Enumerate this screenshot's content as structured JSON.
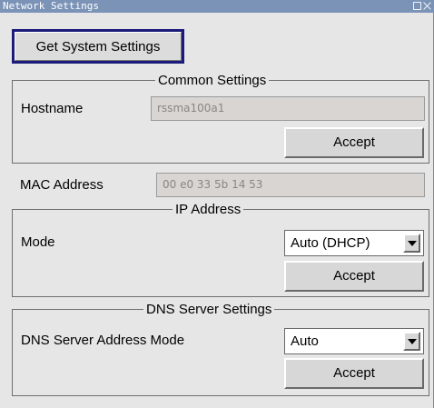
{
  "window": {
    "title": "Network Settings"
  },
  "get_system_settings": {
    "label": "Get System Settings"
  },
  "common_settings": {
    "legend": "Common Settings",
    "hostname_label": "Hostname",
    "hostname_value": "rssma100a1",
    "accept_label": "Accept"
  },
  "mac": {
    "label": "MAC Address",
    "value": "00 e0 33 5b 14 53"
  },
  "ip_address": {
    "legend": "IP Address",
    "mode_label": "Mode",
    "mode_value": "Auto (DHCP)",
    "accept_label": "Accept"
  },
  "dns": {
    "legend": "DNS Server Settings",
    "mode_label": "DNS Server Address Mode",
    "mode_value": "Auto",
    "accept_label": "Accept"
  },
  "icons": [
    "maximize-icon",
    "close-icon",
    "chevron-down-icon"
  ],
  "colors": {
    "titlebar": "#7b93b7",
    "panel": "#e6e6e6",
    "focus_border": "#1b1b7a"
  }
}
